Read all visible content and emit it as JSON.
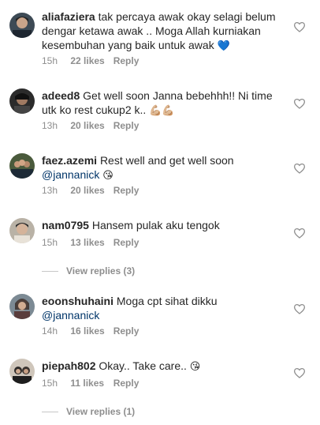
{
  "comments": [
    {
      "username": "aliafaziera",
      "text": "tak percaya awak okay selagi belum dengar ketawa awak .. Moga Allah kurniakan kesembuhan yang baik untuk awak",
      "emoji": "💙",
      "time": "15h",
      "likes": "22 likes",
      "reply": "Reply"
    },
    {
      "username": "adeed8",
      "text": "Get well soon Janna bebehhh!! Ni time utk ko rest cukup2 k..",
      "emoji": "💪🏼💪🏼",
      "time": "13h",
      "likes": "20 likes",
      "reply": "Reply"
    },
    {
      "username": "faez.azemi",
      "text": "Rest well and get well soon",
      "mention": "@jannanick",
      "emoji": "😘",
      "time": "13h",
      "likes": "20 likes",
      "reply": "Reply"
    },
    {
      "username": "nam0795",
      "text": "Hansem pulak aku tengok",
      "time": "15h",
      "likes": "13 likes",
      "reply": "Reply",
      "view_replies": "View replies (3)"
    },
    {
      "username": "eoonshuhaini",
      "text": "Moga cpt sihat dikku",
      "mention": "@jannanick",
      "time": "14h",
      "likes": "16 likes",
      "reply": "Reply"
    },
    {
      "username": "piepah802",
      "text": "Okay.. Take care..",
      "emoji": "😘",
      "time": "15h",
      "likes": "11 likes",
      "reply": "Reply",
      "view_replies": "View replies (1)"
    }
  ],
  "icons": {
    "like": "heart-outline-icon"
  },
  "colors": {
    "text": "#262626",
    "meta": "#8e8e8e",
    "mention": "#003569",
    "heart_stroke": "#8e8e8e"
  }
}
